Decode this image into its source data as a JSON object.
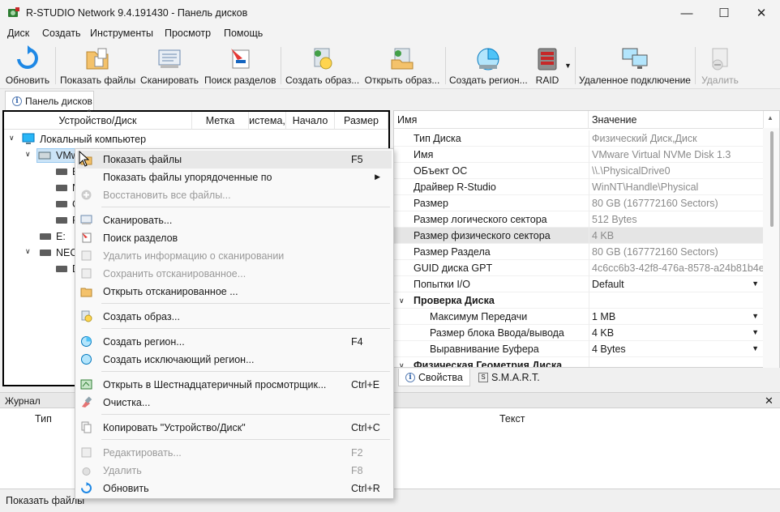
{
  "window": {
    "title": "R-STUDIO Network 9.4.191430 - Панель дисков",
    "minimize": "—",
    "maximize": "☐",
    "close": "✕"
  },
  "menu": [
    "Диск",
    "Создать",
    "Инструменты",
    "Просмотр",
    "Помощь"
  ],
  "toolbar": [
    {
      "label": "Обновить",
      "icon": "refresh-icon",
      "enabled": true
    },
    {
      "label": "Показать файлы",
      "icon": "show-files-icon",
      "enabled": true
    },
    {
      "label": "Сканировать",
      "icon": "scan-icon",
      "enabled": true
    },
    {
      "label": "Поиск разделов",
      "icon": "search-partitions-icon",
      "enabled": true
    },
    {
      "label": "Создать образ...",
      "icon": "create-image-icon",
      "enabled": true
    },
    {
      "label": "Открыть образ...",
      "icon": "open-image-icon",
      "enabled": true
    },
    {
      "label": "Создать регион...",
      "icon": "create-region-icon",
      "enabled": true
    },
    {
      "label": "RAID",
      "icon": "raid-icon",
      "enabled": true
    },
    {
      "label": "Удаленное подключение",
      "icon": "remote-connect-icon",
      "enabled": true
    },
    {
      "label": "Удалить",
      "icon": "delete-icon",
      "enabled": false
    }
  ],
  "tab": {
    "label": "Панель дисков"
  },
  "left_pane": {
    "columns": [
      "Устройство/Диск",
      "Метка",
      "истема,",
      "Начало",
      "Размер"
    ],
    "tree": [
      {
        "label": "Локальный компьютер",
        "level": 0,
        "expanded": true,
        "icon": "computer-icon"
      },
      {
        "label": "VMw",
        "level": 1,
        "expanded": true,
        "icon": "disk-icon",
        "selected": true
      },
      {
        "label": "E",
        "level": 2,
        "icon": "drive-icon"
      },
      {
        "label": "N",
        "level": 2,
        "icon": "drive-icon"
      },
      {
        "label": "C",
        "level": 2,
        "icon": "drive-icon"
      },
      {
        "label": "F",
        "level": 2,
        "icon": "drive-icon"
      },
      {
        "label": "E:",
        "level": 1,
        "icon": "drive-icon"
      },
      {
        "label": "NEC",
        "level": 1,
        "expanded": true,
        "icon": "disk-icon"
      },
      {
        "label": "D",
        "level": 2,
        "icon": "drive-icon"
      }
    ]
  },
  "right_pane": {
    "columns": [
      "Имя",
      "Значение"
    ],
    "rows": [
      {
        "name": "Тип Диска",
        "value": "Физический Диск,Диск",
        "indent": 1
      },
      {
        "name": "Имя",
        "value": "VMware Virtual NVMe Disk 1.3",
        "indent": 1
      },
      {
        "name": "ОБъект ОС",
        "value": "\\\\.\\PhysicalDrive0",
        "indent": 1
      },
      {
        "name": "Драйвер R-Studio",
        "value": "WinNT\\Handle\\Physical",
        "indent": 1
      },
      {
        "name": "Размер",
        "value": "80 GB (167772160 Sectors)",
        "indent": 1
      },
      {
        "name": "Размер логического сектора",
        "value": "512 Bytes",
        "indent": 1
      },
      {
        "name": "Размер физического сектора",
        "value": "4 KB",
        "indent": 1,
        "highlighted": true
      },
      {
        "name": "Размер Раздела",
        "value": "80 GB (167772160 Sectors)",
        "indent": 1
      },
      {
        "name": "GUID диска GPT",
        "value": "4c6cc6b3-42f8-476a-8578-a24b81b4e...",
        "indent": 1
      },
      {
        "name": "Попытки I/O",
        "value": "Default",
        "indent": 1,
        "editable": true
      },
      {
        "name": "Проверка Диска",
        "value": "",
        "indent": 0,
        "group": true
      },
      {
        "name": "Максимум Передачи",
        "value": "1 MB",
        "indent": 2,
        "editable": true
      },
      {
        "name": "Размер блока Ввода/вывода",
        "value": "4 KB",
        "indent": 2,
        "editable": true
      },
      {
        "name": "Выравнивание Буфера",
        "value": "4 Bytes",
        "indent": 2,
        "editable": true
      },
      {
        "name": "Физическая Геометрия Диска",
        "value": "",
        "indent": 0,
        "group": true
      }
    ],
    "tabs": [
      "Свойства",
      "S.M.A.R.T."
    ]
  },
  "journal": {
    "title": "Журнал",
    "columns": [
      "Тип",
      "Текст"
    ],
    "close": "✕"
  },
  "status": "Показать файлы",
  "context_menu": [
    {
      "label": "Показать файлы",
      "shortcut": "F5",
      "enabled": true,
      "highlighted": true,
      "icon": "show-files-icon"
    },
    {
      "label": "Показать файлы упорядоченные по",
      "shortcut": "",
      "enabled": true,
      "submenu": true,
      "icon": ""
    },
    {
      "label": "Восстановить все файлы...",
      "shortcut": "",
      "enabled": false,
      "icon": "recover-icon"
    },
    {
      "sep": true
    },
    {
      "label": "Сканировать...",
      "shortcut": "",
      "enabled": true,
      "icon": "scan-icon"
    },
    {
      "label": "Поиск разделов",
      "shortcut": "",
      "enabled": true,
      "icon": "search-partitions-icon"
    },
    {
      "label": "Удалить информацию о сканировании",
      "shortcut": "",
      "enabled": false,
      "icon": "delete-scan-icon"
    },
    {
      "label": "Сохранить отсканированное...",
      "shortcut": "",
      "enabled": false,
      "icon": "save-scan-icon"
    },
    {
      "label": "Открыть отсканированное ...",
      "shortcut": "",
      "enabled": true,
      "icon": "open-scan-icon"
    },
    {
      "sep": true
    },
    {
      "label": "Создать образ...",
      "shortcut": "",
      "enabled": true,
      "icon": "create-image-icon"
    },
    {
      "sep": true
    },
    {
      "label": "Создать регион...",
      "shortcut": "F4",
      "enabled": true,
      "icon": "create-region-icon"
    },
    {
      "label": "Создать исключающий регион...",
      "shortcut": "",
      "enabled": true,
      "icon": "exclude-region-icon"
    },
    {
      "sep": true
    },
    {
      "label": "Открыть в Шестнадцатеричный просмотрщик...",
      "shortcut": "Ctrl+E",
      "enabled": true,
      "icon": "hex-viewer-icon"
    },
    {
      "label": "Очистка...",
      "shortcut": "",
      "enabled": true,
      "icon": "wipe-icon"
    },
    {
      "sep": true
    },
    {
      "label": "Копировать \"Устройство/Диск\"",
      "shortcut": "Ctrl+C",
      "enabled": true,
      "icon": "copy-icon"
    },
    {
      "sep": true
    },
    {
      "label": "Редактировать...",
      "shortcut": "F2",
      "enabled": false,
      "icon": "edit-icon"
    },
    {
      "label": "Удалить",
      "shortcut": "F8",
      "enabled": false,
      "icon": "delete-icon"
    },
    {
      "label": "Обновить",
      "shortcut": "Ctrl+R",
      "enabled": true,
      "icon": "refresh-icon"
    }
  ]
}
